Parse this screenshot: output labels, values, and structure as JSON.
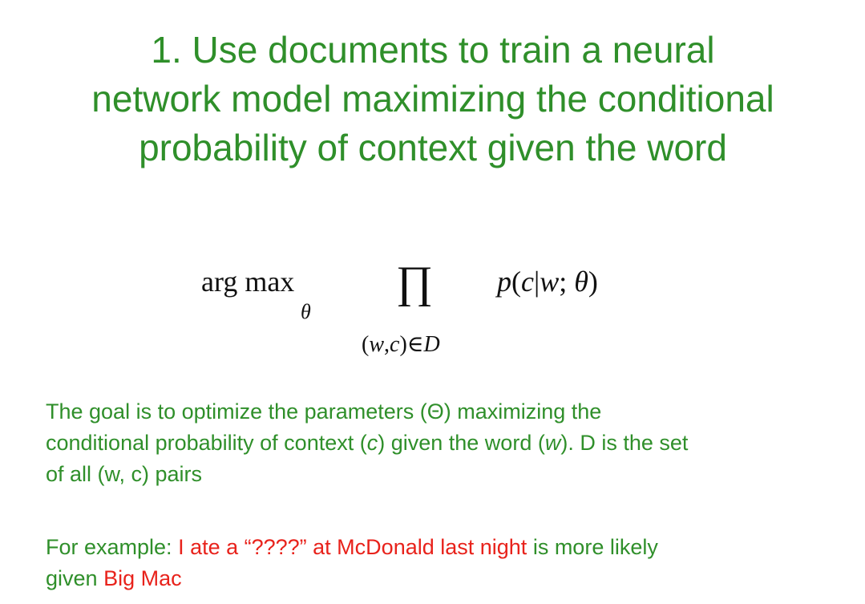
{
  "title": {
    "line1": "1. Use documents to train a neural",
    "line2": "network model maximizing the conditional",
    "line3": "probability of context given the word"
  },
  "formula": {
    "argmax": "arg max",
    "argmax_sub": "θ",
    "product": "∏",
    "product_sub_open": "(",
    "product_sub_w": "w",
    "product_sub_comma": ",",
    "product_sub_c": "c",
    "product_sub_close": ")∈",
    "product_sub_D": "D",
    "prob_p": "p",
    "prob_open": "(",
    "prob_c": "c",
    "prob_bar": "|",
    "prob_w": "w",
    "prob_semi": "; ",
    "prob_theta": "θ",
    "prob_close": ")"
  },
  "description": {
    "line1": "The goal is to optimize the parameters (Θ) maximizing the",
    "line2_a": "conditional probability of context (",
    "line2_c": "c",
    "line2_b": ") given the word (",
    "line2_w": "w",
    "line2_d": "). D is the set",
    "line3": "of all (w, c) pairs"
  },
  "example": {
    "label": "For example: ",
    "sentence": "I ate a “????” at McDonald last night",
    "middle": " is more likely",
    "given": "given ",
    "answer": "Big Mac"
  },
  "colors": {
    "green": "#2f8f2a",
    "red": "#e8221b",
    "formula": "#111111"
  }
}
